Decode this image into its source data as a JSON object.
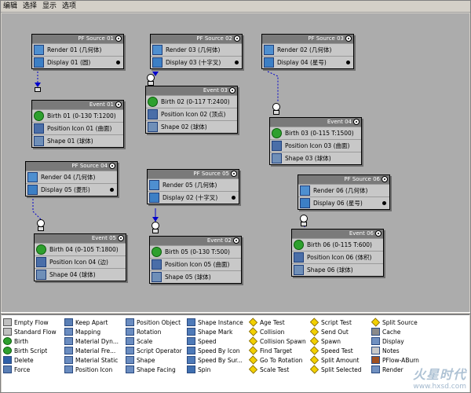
{
  "menu": [
    "编辑",
    "选择",
    "显示",
    "选项"
  ],
  "sources": [
    {
      "title": "PF Source 01",
      "render": "Render 01 (几何体)",
      "display": "Display 01 (圆)"
    },
    {
      "title": "PF Source 02",
      "render": "Render 03 (几何体)",
      "display": "Display 03 (十字叉)"
    },
    {
      "title": "PF Source 03",
      "render": "Render 02 (几何体)",
      "display": "Display 04 (星号)"
    },
    {
      "title": "PF Source 04",
      "render": "Render 04 (几何体)",
      "display": "Display 05 (菱形)"
    },
    {
      "title": "PF Source 05",
      "render": "Render 05 (几何体)",
      "display": "Display 02 (十字叉)"
    },
    {
      "title": "PF Source 06",
      "render": "Render 06 (几何体)",
      "display": "Display 06 (星号)"
    }
  ],
  "events": [
    {
      "title": "Event 01",
      "birth": "Birth 01 (0-130 T:1200)",
      "pos": "Position Icon 01 (曲面)",
      "shape": "Shape 01 (球体)"
    },
    {
      "title": "Event 03",
      "birth": "Birth 02 (0-117 T:2400)",
      "pos": "Position Icon 02 (顶点)",
      "shape": "Shape 02 (球体)"
    },
    {
      "title": "Event 04",
      "birth": "Birth 03 (0-115 T:1500)",
      "pos": "Position Icon 03 (曲面)",
      "shape": "Shape 03 (球体)"
    },
    {
      "title": "Event 05",
      "birth": "Birth 04 (0-105 T:1800)",
      "pos": "Position Icon 04 (边)",
      "shape": "Shape 04 (球体)"
    },
    {
      "title": "Event 02",
      "birth": "Birth 05 (0-130 T:500)",
      "pos": "Position Icon 05 (曲面)",
      "shape": "Shape 05 (球体)"
    },
    {
      "title": "Event 06",
      "birth": "Birth 06 (0-115 T:600)",
      "pos": "Position Icon 06 (体积)",
      "shape": "Shape 06 (球体)"
    }
  ],
  "depot": [
    [
      {
        "label": "Empty Flow",
        "icon": "flow"
      },
      {
        "label": "Standard Flow",
        "icon": "flow"
      },
      {
        "label": "Birth",
        "icon": "birthico"
      },
      {
        "label": "Birth Script",
        "icon": "birthico"
      },
      {
        "label": "Delete",
        "icon": "delete"
      },
      {
        "label": "Force",
        "icon": "force"
      }
    ],
    [
      {
        "label": "Keep Apart",
        "icon": "force"
      },
      {
        "label": "Mapping",
        "icon": "mat"
      },
      {
        "label": "Material Dyn...",
        "icon": "mat"
      },
      {
        "label": "Material Fre...",
        "icon": "mat"
      },
      {
        "label": "Material Static",
        "icon": "mat"
      },
      {
        "label": "Position Icon",
        "icon": "mat"
      }
    ],
    [
      {
        "label": "Position Object",
        "icon": "mat"
      },
      {
        "label": "Rotation",
        "icon": "mat"
      },
      {
        "label": "Scale",
        "icon": "mat"
      },
      {
        "label": "Script Operator",
        "icon": "mat"
      },
      {
        "label": "Shape",
        "icon": "mat"
      },
      {
        "label": "Shape Facing",
        "icon": "mat"
      }
    ],
    [
      {
        "label": "Shape Instance",
        "icon": "spd"
      },
      {
        "label": "Shape Mark",
        "icon": "spd"
      },
      {
        "label": "Speed",
        "icon": "spd"
      },
      {
        "label": "Speed By Icon",
        "icon": "spd"
      },
      {
        "label": "Speed By Sur...",
        "icon": "spd"
      },
      {
        "label": "Spin",
        "icon": "spin"
      }
    ],
    [
      {
        "label": "Age Test",
        "icon": "test"
      },
      {
        "label": "Collision",
        "icon": "test"
      },
      {
        "label": "Collision Spawn",
        "icon": "test"
      },
      {
        "label": "Find Target",
        "icon": "test"
      },
      {
        "label": "Go To Rotation",
        "icon": "test"
      },
      {
        "label": "Scale Test",
        "icon": "test"
      }
    ],
    [
      {
        "label": "Script Test",
        "icon": "test"
      },
      {
        "label": "Send Out",
        "icon": "test"
      },
      {
        "label": "Spawn",
        "icon": "test"
      },
      {
        "label": "Speed Test",
        "icon": "test"
      },
      {
        "label": "Split Amount",
        "icon": "test"
      },
      {
        "label": "Split Selected",
        "icon": "test"
      }
    ],
    [
      {
        "label": "Split Source",
        "icon": "test"
      },
      {
        "label": "Cache",
        "icon": "cache"
      },
      {
        "label": "Display",
        "icon": "black"
      },
      {
        "label": "Notes",
        "icon": "notes"
      },
      {
        "label": "PFlow-ABurn",
        "icon": "pflow"
      },
      {
        "label": "Render",
        "icon": "black"
      }
    ]
  ],
  "watermark": {
    "title": "火星时代",
    "url": "www.hxsd.com"
  },
  "colors": {
    "canvas": "#acacac",
    "node_title": "#7a7a7a",
    "wire": "#0000cc"
  }
}
